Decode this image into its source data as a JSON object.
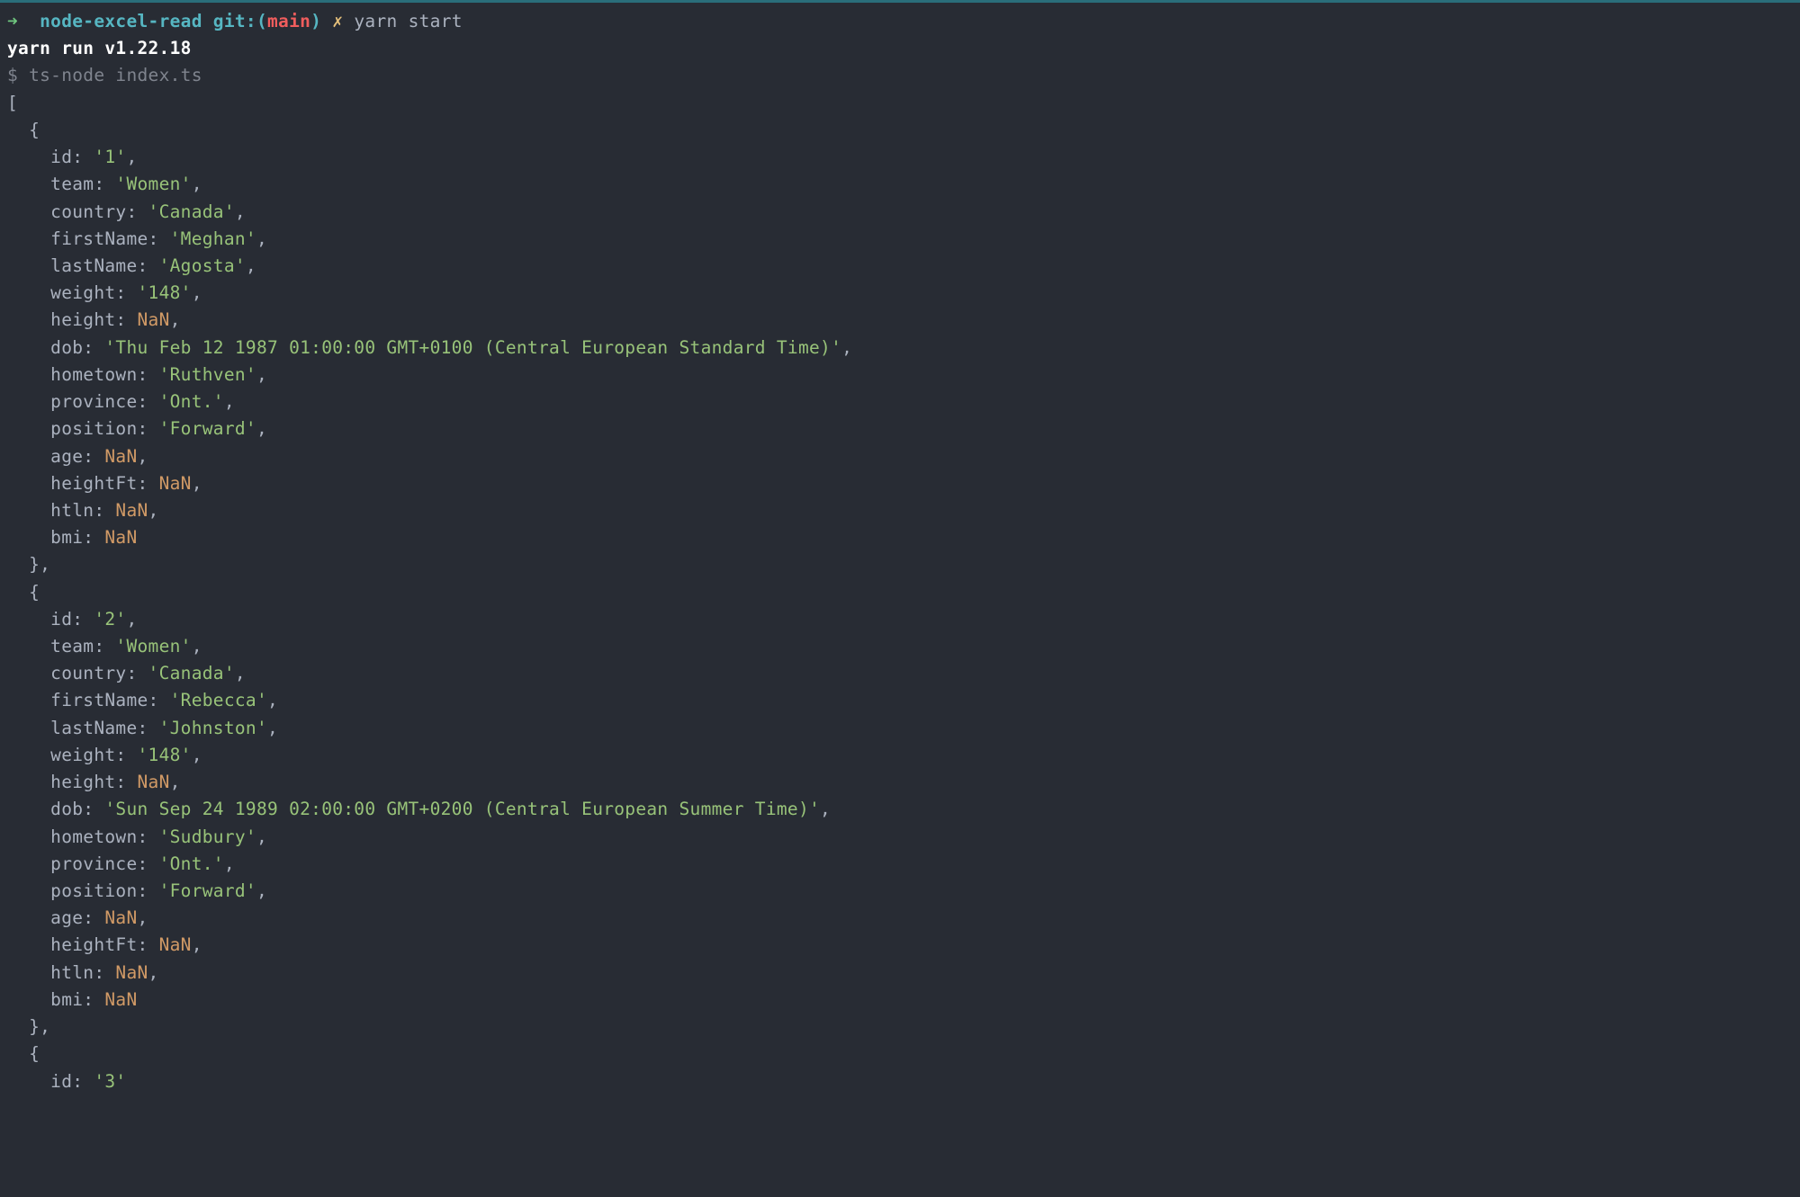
{
  "prompt": {
    "arrow": "➜",
    "dir": "node-excel-read",
    "git_prefix": "git:(",
    "branch": "main",
    "git_suffix": ")",
    "dirty_mark": "✗",
    "command": "yarn",
    "command_arg": "start"
  },
  "yarn_line": "yarn run v1.22.18",
  "sub_command_prefix": "$",
  "sub_command": "ts-node index.ts",
  "records": [
    {
      "id": "1",
      "team": "Women",
      "country": "Canada",
      "firstName": "Meghan",
      "lastName": "Agosta",
      "weight": "148",
      "height": "NaN",
      "dob": "Thu Feb 12 1987 01:00:00 GMT+0100 (Central European Standard Time)",
      "hometown": "Ruthven",
      "province": "Ont.",
      "position": "Forward",
      "age": "NaN",
      "heightFt": "NaN",
      "htln": "NaN",
      "bmi": "NaN"
    },
    {
      "id": "2",
      "team": "Women",
      "country": "Canada",
      "firstName": "Rebecca",
      "lastName": "Johnston",
      "weight": "148",
      "height": "NaN",
      "dob": "Sun Sep 24 1989 02:00:00 GMT+0200 (Central European Summer Time)",
      "hometown": "Sudbury",
      "province": "Ont.",
      "position": "Forward",
      "age": "NaN",
      "heightFt": "NaN",
      "htln": "NaN",
      "bmi": "NaN"
    },
    {
      "id": "3"
    }
  ]
}
